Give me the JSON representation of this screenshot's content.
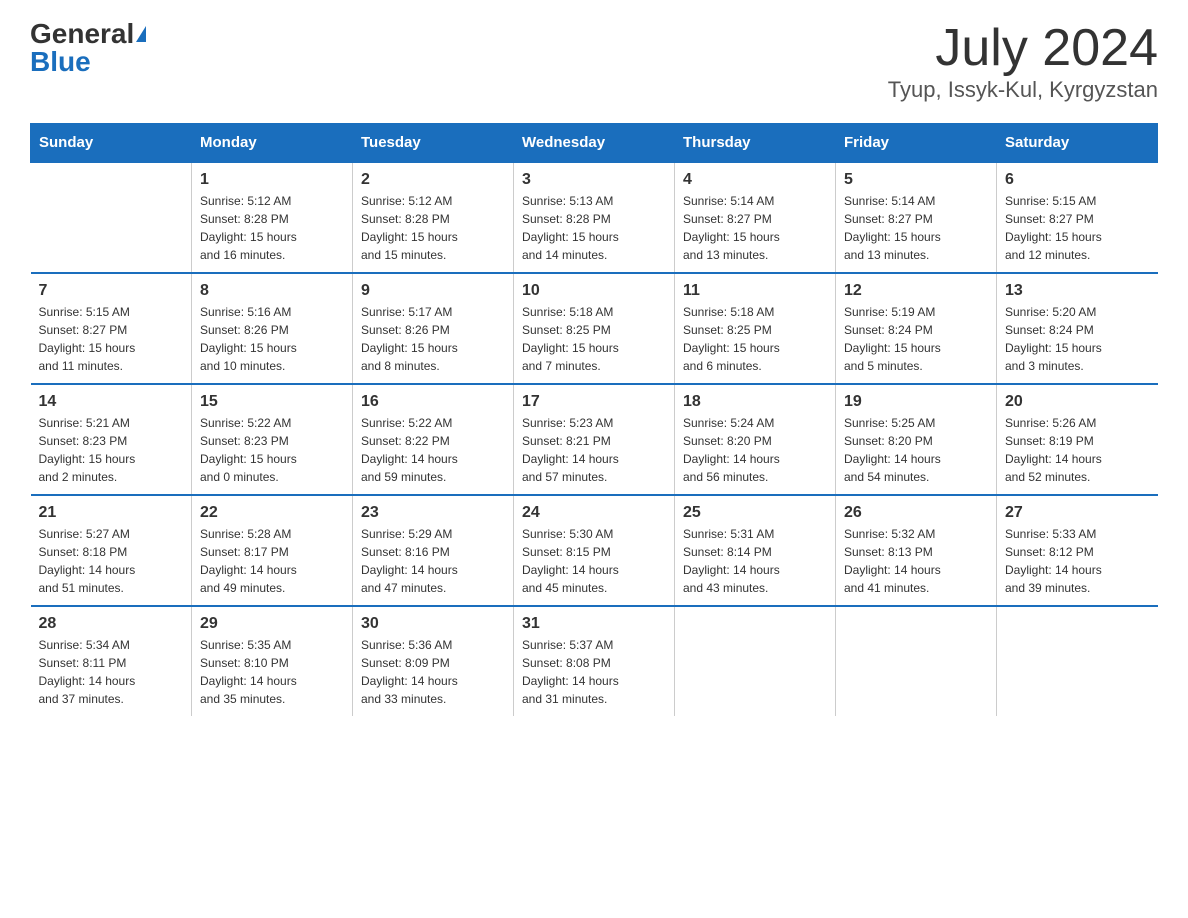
{
  "header": {
    "logo_general": "General",
    "logo_blue": "Blue",
    "title": "July 2024",
    "subtitle": "Tyup, Issyk-Kul, Kyrgyzstan"
  },
  "days_of_week": [
    "Sunday",
    "Monday",
    "Tuesday",
    "Wednesday",
    "Thursday",
    "Friday",
    "Saturday"
  ],
  "weeks": [
    [
      {
        "day": "",
        "info": ""
      },
      {
        "day": "1",
        "info": "Sunrise: 5:12 AM\nSunset: 8:28 PM\nDaylight: 15 hours\nand 16 minutes."
      },
      {
        "day": "2",
        "info": "Sunrise: 5:12 AM\nSunset: 8:28 PM\nDaylight: 15 hours\nand 15 minutes."
      },
      {
        "day": "3",
        "info": "Sunrise: 5:13 AM\nSunset: 8:28 PM\nDaylight: 15 hours\nand 14 minutes."
      },
      {
        "day": "4",
        "info": "Sunrise: 5:14 AM\nSunset: 8:27 PM\nDaylight: 15 hours\nand 13 minutes."
      },
      {
        "day": "5",
        "info": "Sunrise: 5:14 AM\nSunset: 8:27 PM\nDaylight: 15 hours\nand 13 minutes."
      },
      {
        "day": "6",
        "info": "Sunrise: 5:15 AM\nSunset: 8:27 PM\nDaylight: 15 hours\nand 12 minutes."
      }
    ],
    [
      {
        "day": "7",
        "info": "Sunrise: 5:15 AM\nSunset: 8:27 PM\nDaylight: 15 hours\nand 11 minutes."
      },
      {
        "day": "8",
        "info": "Sunrise: 5:16 AM\nSunset: 8:26 PM\nDaylight: 15 hours\nand 10 minutes."
      },
      {
        "day": "9",
        "info": "Sunrise: 5:17 AM\nSunset: 8:26 PM\nDaylight: 15 hours\nand 8 minutes."
      },
      {
        "day": "10",
        "info": "Sunrise: 5:18 AM\nSunset: 8:25 PM\nDaylight: 15 hours\nand 7 minutes."
      },
      {
        "day": "11",
        "info": "Sunrise: 5:18 AM\nSunset: 8:25 PM\nDaylight: 15 hours\nand 6 minutes."
      },
      {
        "day": "12",
        "info": "Sunrise: 5:19 AM\nSunset: 8:24 PM\nDaylight: 15 hours\nand 5 minutes."
      },
      {
        "day": "13",
        "info": "Sunrise: 5:20 AM\nSunset: 8:24 PM\nDaylight: 15 hours\nand 3 minutes."
      }
    ],
    [
      {
        "day": "14",
        "info": "Sunrise: 5:21 AM\nSunset: 8:23 PM\nDaylight: 15 hours\nand 2 minutes."
      },
      {
        "day": "15",
        "info": "Sunrise: 5:22 AM\nSunset: 8:23 PM\nDaylight: 15 hours\nand 0 minutes."
      },
      {
        "day": "16",
        "info": "Sunrise: 5:22 AM\nSunset: 8:22 PM\nDaylight: 14 hours\nand 59 minutes."
      },
      {
        "day": "17",
        "info": "Sunrise: 5:23 AM\nSunset: 8:21 PM\nDaylight: 14 hours\nand 57 minutes."
      },
      {
        "day": "18",
        "info": "Sunrise: 5:24 AM\nSunset: 8:20 PM\nDaylight: 14 hours\nand 56 minutes."
      },
      {
        "day": "19",
        "info": "Sunrise: 5:25 AM\nSunset: 8:20 PM\nDaylight: 14 hours\nand 54 minutes."
      },
      {
        "day": "20",
        "info": "Sunrise: 5:26 AM\nSunset: 8:19 PM\nDaylight: 14 hours\nand 52 minutes."
      }
    ],
    [
      {
        "day": "21",
        "info": "Sunrise: 5:27 AM\nSunset: 8:18 PM\nDaylight: 14 hours\nand 51 minutes."
      },
      {
        "day": "22",
        "info": "Sunrise: 5:28 AM\nSunset: 8:17 PM\nDaylight: 14 hours\nand 49 minutes."
      },
      {
        "day": "23",
        "info": "Sunrise: 5:29 AM\nSunset: 8:16 PM\nDaylight: 14 hours\nand 47 minutes."
      },
      {
        "day": "24",
        "info": "Sunrise: 5:30 AM\nSunset: 8:15 PM\nDaylight: 14 hours\nand 45 minutes."
      },
      {
        "day": "25",
        "info": "Sunrise: 5:31 AM\nSunset: 8:14 PM\nDaylight: 14 hours\nand 43 minutes."
      },
      {
        "day": "26",
        "info": "Sunrise: 5:32 AM\nSunset: 8:13 PM\nDaylight: 14 hours\nand 41 minutes."
      },
      {
        "day": "27",
        "info": "Sunrise: 5:33 AM\nSunset: 8:12 PM\nDaylight: 14 hours\nand 39 minutes."
      }
    ],
    [
      {
        "day": "28",
        "info": "Sunrise: 5:34 AM\nSunset: 8:11 PM\nDaylight: 14 hours\nand 37 minutes."
      },
      {
        "day": "29",
        "info": "Sunrise: 5:35 AM\nSunset: 8:10 PM\nDaylight: 14 hours\nand 35 minutes."
      },
      {
        "day": "30",
        "info": "Sunrise: 5:36 AM\nSunset: 8:09 PM\nDaylight: 14 hours\nand 33 minutes."
      },
      {
        "day": "31",
        "info": "Sunrise: 5:37 AM\nSunset: 8:08 PM\nDaylight: 14 hours\nand 31 minutes."
      },
      {
        "day": "",
        "info": ""
      },
      {
        "day": "",
        "info": ""
      },
      {
        "day": "",
        "info": ""
      }
    ]
  ]
}
